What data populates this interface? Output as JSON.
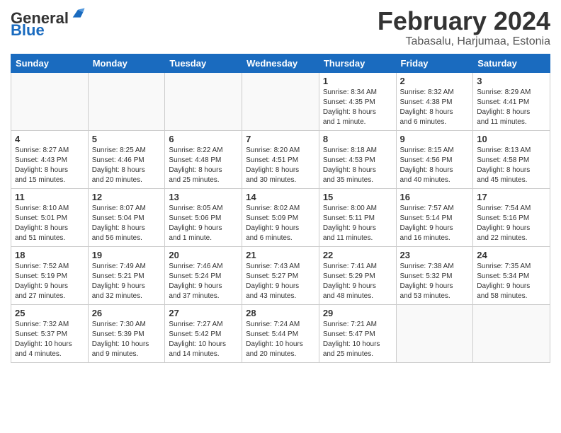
{
  "logo": {
    "text_general": "General",
    "text_blue": "Blue"
  },
  "header": {
    "month_year": "February 2024",
    "location": "Tabasalu, Harjumaa, Estonia"
  },
  "weekdays": [
    "Sunday",
    "Monday",
    "Tuesday",
    "Wednesday",
    "Thursday",
    "Friday",
    "Saturday"
  ],
  "weeks": [
    {
      "days": [
        {
          "num": "",
          "info": ""
        },
        {
          "num": "",
          "info": ""
        },
        {
          "num": "",
          "info": ""
        },
        {
          "num": "",
          "info": ""
        },
        {
          "num": "1",
          "info": "Sunrise: 8:34 AM\nSunset: 4:35 PM\nDaylight: 8 hours\nand 1 minute."
        },
        {
          "num": "2",
          "info": "Sunrise: 8:32 AM\nSunset: 4:38 PM\nDaylight: 8 hours\nand 6 minutes."
        },
        {
          "num": "3",
          "info": "Sunrise: 8:29 AM\nSunset: 4:41 PM\nDaylight: 8 hours\nand 11 minutes."
        }
      ]
    },
    {
      "days": [
        {
          "num": "4",
          "info": "Sunrise: 8:27 AM\nSunset: 4:43 PM\nDaylight: 8 hours\nand 15 minutes."
        },
        {
          "num": "5",
          "info": "Sunrise: 8:25 AM\nSunset: 4:46 PM\nDaylight: 8 hours\nand 20 minutes."
        },
        {
          "num": "6",
          "info": "Sunrise: 8:22 AM\nSunset: 4:48 PM\nDaylight: 8 hours\nand 25 minutes."
        },
        {
          "num": "7",
          "info": "Sunrise: 8:20 AM\nSunset: 4:51 PM\nDaylight: 8 hours\nand 30 minutes."
        },
        {
          "num": "8",
          "info": "Sunrise: 8:18 AM\nSunset: 4:53 PM\nDaylight: 8 hours\nand 35 minutes."
        },
        {
          "num": "9",
          "info": "Sunrise: 8:15 AM\nSunset: 4:56 PM\nDaylight: 8 hours\nand 40 minutes."
        },
        {
          "num": "10",
          "info": "Sunrise: 8:13 AM\nSunset: 4:58 PM\nDaylight: 8 hours\nand 45 minutes."
        }
      ]
    },
    {
      "days": [
        {
          "num": "11",
          "info": "Sunrise: 8:10 AM\nSunset: 5:01 PM\nDaylight: 8 hours\nand 51 minutes."
        },
        {
          "num": "12",
          "info": "Sunrise: 8:07 AM\nSunset: 5:04 PM\nDaylight: 8 hours\nand 56 minutes."
        },
        {
          "num": "13",
          "info": "Sunrise: 8:05 AM\nSunset: 5:06 PM\nDaylight: 9 hours\nand 1 minute."
        },
        {
          "num": "14",
          "info": "Sunrise: 8:02 AM\nSunset: 5:09 PM\nDaylight: 9 hours\nand 6 minutes."
        },
        {
          "num": "15",
          "info": "Sunrise: 8:00 AM\nSunset: 5:11 PM\nDaylight: 9 hours\nand 11 minutes."
        },
        {
          "num": "16",
          "info": "Sunrise: 7:57 AM\nSunset: 5:14 PM\nDaylight: 9 hours\nand 16 minutes."
        },
        {
          "num": "17",
          "info": "Sunrise: 7:54 AM\nSunset: 5:16 PM\nDaylight: 9 hours\nand 22 minutes."
        }
      ]
    },
    {
      "days": [
        {
          "num": "18",
          "info": "Sunrise: 7:52 AM\nSunset: 5:19 PM\nDaylight: 9 hours\nand 27 minutes."
        },
        {
          "num": "19",
          "info": "Sunrise: 7:49 AM\nSunset: 5:21 PM\nDaylight: 9 hours\nand 32 minutes."
        },
        {
          "num": "20",
          "info": "Sunrise: 7:46 AM\nSunset: 5:24 PM\nDaylight: 9 hours\nand 37 minutes."
        },
        {
          "num": "21",
          "info": "Sunrise: 7:43 AM\nSunset: 5:27 PM\nDaylight: 9 hours\nand 43 minutes."
        },
        {
          "num": "22",
          "info": "Sunrise: 7:41 AM\nSunset: 5:29 PM\nDaylight: 9 hours\nand 48 minutes."
        },
        {
          "num": "23",
          "info": "Sunrise: 7:38 AM\nSunset: 5:32 PM\nDaylight: 9 hours\nand 53 minutes."
        },
        {
          "num": "24",
          "info": "Sunrise: 7:35 AM\nSunset: 5:34 PM\nDaylight: 9 hours\nand 58 minutes."
        }
      ]
    },
    {
      "days": [
        {
          "num": "25",
          "info": "Sunrise: 7:32 AM\nSunset: 5:37 PM\nDaylight: 10 hours\nand 4 minutes."
        },
        {
          "num": "26",
          "info": "Sunrise: 7:30 AM\nSunset: 5:39 PM\nDaylight: 10 hours\nand 9 minutes."
        },
        {
          "num": "27",
          "info": "Sunrise: 7:27 AM\nSunset: 5:42 PM\nDaylight: 10 hours\nand 14 minutes."
        },
        {
          "num": "28",
          "info": "Sunrise: 7:24 AM\nSunset: 5:44 PM\nDaylight: 10 hours\nand 20 minutes."
        },
        {
          "num": "29",
          "info": "Sunrise: 7:21 AM\nSunset: 5:47 PM\nDaylight: 10 hours\nand 25 minutes."
        },
        {
          "num": "",
          "info": ""
        },
        {
          "num": "",
          "info": ""
        }
      ]
    }
  ]
}
